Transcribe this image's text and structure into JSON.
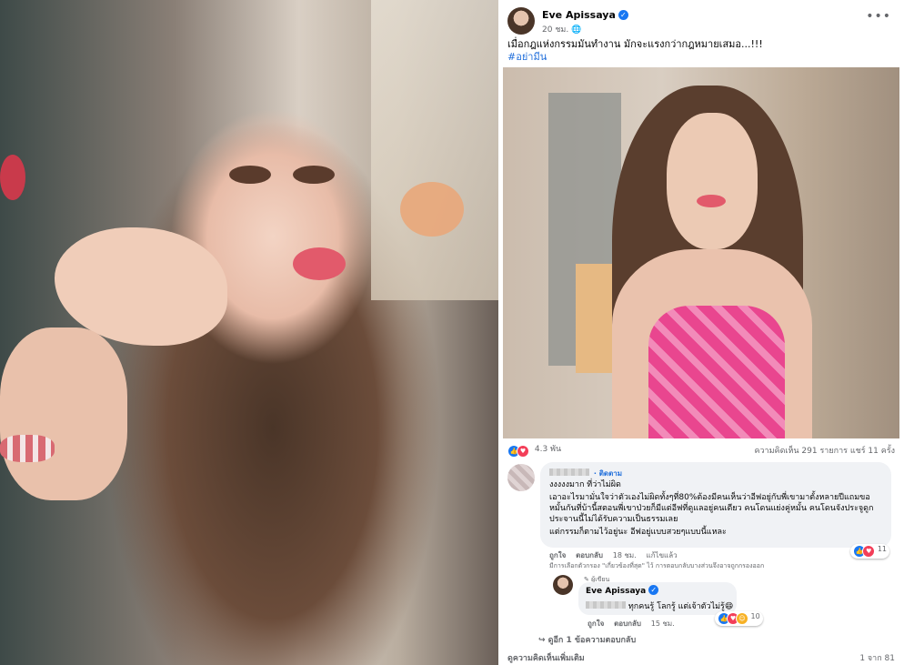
{
  "post": {
    "author": "Eve Apissaya",
    "time": "20 ชม.",
    "globe": "🌐",
    "menu": "•••",
    "text": "เมื่อกฎแห่งกรรมมันทำงาน มักจะแรงกว่ากฎหมายเสมอ...!!!",
    "hashtag": "#อย่ามีน",
    "reaction_count": "4.3 พัน",
    "comments_shares": "ความคิดเห็น 291 รายการ  แชร์ 11 ครั้ง"
  },
  "comment1": {
    "follow": "· ติดตาม",
    "lines": [
      "งงงงงมาก ที่ว่าไม่ผิด",
      "เอาอะไรมามั่นใจว่าตัวเองไม่ผิดทั้งๆที่80%ต้องมีคนเห็นว่าอีฟอยู่กับพี่เขามาตั้งหลายปีแถมขอหมั้นกันที่บ้านี้สตอนพี่เขาป่วยก็มีแต่อีฟที่ดูแลอยู่คนเดียว คนโดนแย่งคู่หมั้น คนโดนจังประจูดูกประจานนี้ไม่ได้รับความเป็นธรรมเลย",
      "แต่กรรมก็ตามไว้อยู่นะ อีฟอยู่แบบสวยๆแบบนี้แหละ"
    ],
    "like": "ถูกใจ",
    "reply": "ตอบกลับ",
    "time": "18 ชม.",
    "edited": "แก้ไขแล้ว",
    "reactions": "11",
    "filter_note": "มีการเลือกตัวกรอง \"เกี่ยวข้องที่สุด\" ไว้ การตอบกลับบางส่วนจึงอาจถูกกรองออก"
  },
  "comment2": {
    "badge": "✎ ผู้เขียน",
    "author": "Eve Apissaya",
    "text": "ทุกคนรู้ โลกรู้ แต่เจ้าตัวไม่รู้😄",
    "like": "ถูกใจ",
    "reply": "ตอบกลับ",
    "time": "15 ชม.",
    "reactions": "10"
  },
  "more_replies": "↪ ดูอีก 1 ข้อความตอบกลับ",
  "more_comments": "ดูความคิดเห็นเพิ่มเติม",
  "pager": "1 จาก 81"
}
